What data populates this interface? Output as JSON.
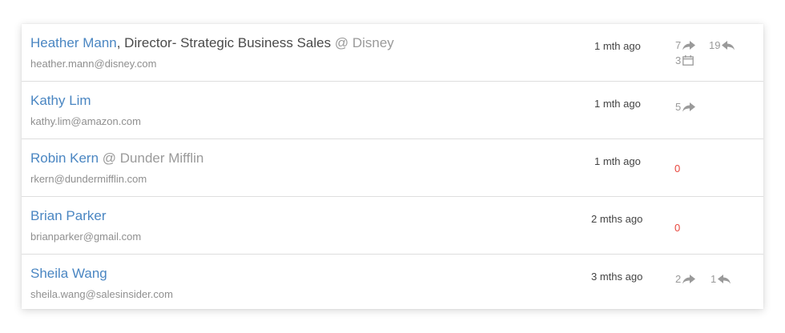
{
  "contacts": [
    {
      "name": "Heather Mann",
      "title": ", Director- Strategic Business Sales",
      "company": " @ Disney",
      "email": "heather.mann@disney.com",
      "time": "1 mth ago",
      "forwards": "7",
      "replies": "19",
      "events": "3"
    },
    {
      "name": "Kathy Lim",
      "title": "",
      "company": "",
      "email": "kathy.lim@amazon.com",
      "time": "1 mth ago",
      "forwards": "5"
    },
    {
      "name": "Robin Kern",
      "title": "",
      "company": " @ Dunder Mifflin",
      "email": "rkern@dundermifflin.com",
      "time": "1 mth ago",
      "zero": "0"
    },
    {
      "name": "Brian Parker",
      "title": "",
      "company": "",
      "email": "brianparker@gmail.com",
      "time": "2 mths ago",
      "zero": "0"
    },
    {
      "name": "Sheila Wang",
      "title": "",
      "company": "",
      "email": "sheila.wang@salesinsider.com",
      "time": "3 mths ago",
      "forwards": "2",
      "replies": "1"
    }
  ],
  "icons": {
    "forward": "forward-arrow-icon",
    "reply": "reply-arrow-icon",
    "event": "calendar-icon"
  },
  "colors": {
    "name_link": "#4a86c2",
    "zero_count": "#e8453c",
    "muted": "#9a9a9a"
  }
}
